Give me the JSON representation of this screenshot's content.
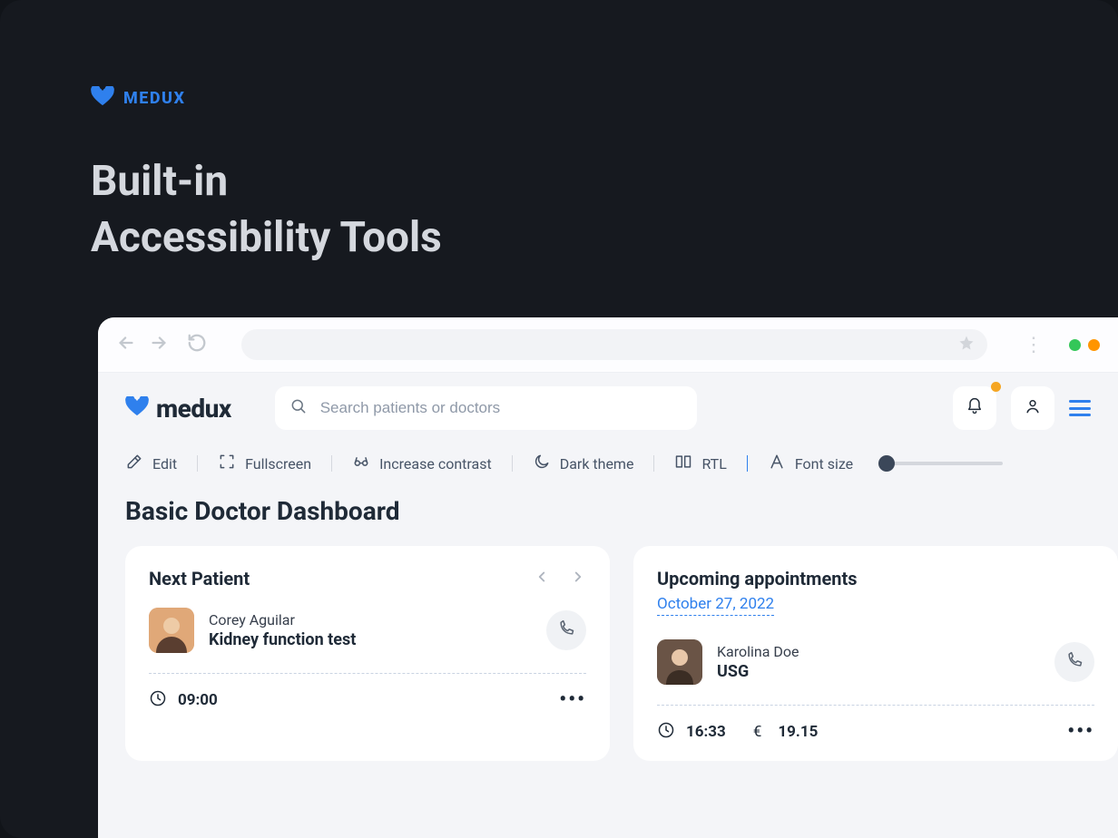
{
  "hero": {
    "logo_text": "MEDUX",
    "title_line1": "Built-in",
    "title_line2": "Accessibility Tools"
  },
  "app": {
    "logo_text": "medux",
    "search_placeholder": "Search patients or doctors"
  },
  "toolbar": {
    "edit": "Edit",
    "fullscreen": "Fullscreen",
    "contrast": "Increase contrast",
    "dark": "Dark theme",
    "rtl": "RTL",
    "font": "Font size"
  },
  "page": {
    "title": "Basic Doctor Dashboard"
  },
  "next_patient": {
    "card_title": "Next Patient",
    "name": "Corey Aguilar",
    "desc": "Kidney function test",
    "time": "09:00"
  },
  "upcoming": {
    "card_title": "Upcoming appointments",
    "date": "October 27, 2022",
    "name": "Karolina Doe",
    "desc": "USG",
    "time": "16:33",
    "currency": "€",
    "price": "19.15"
  }
}
